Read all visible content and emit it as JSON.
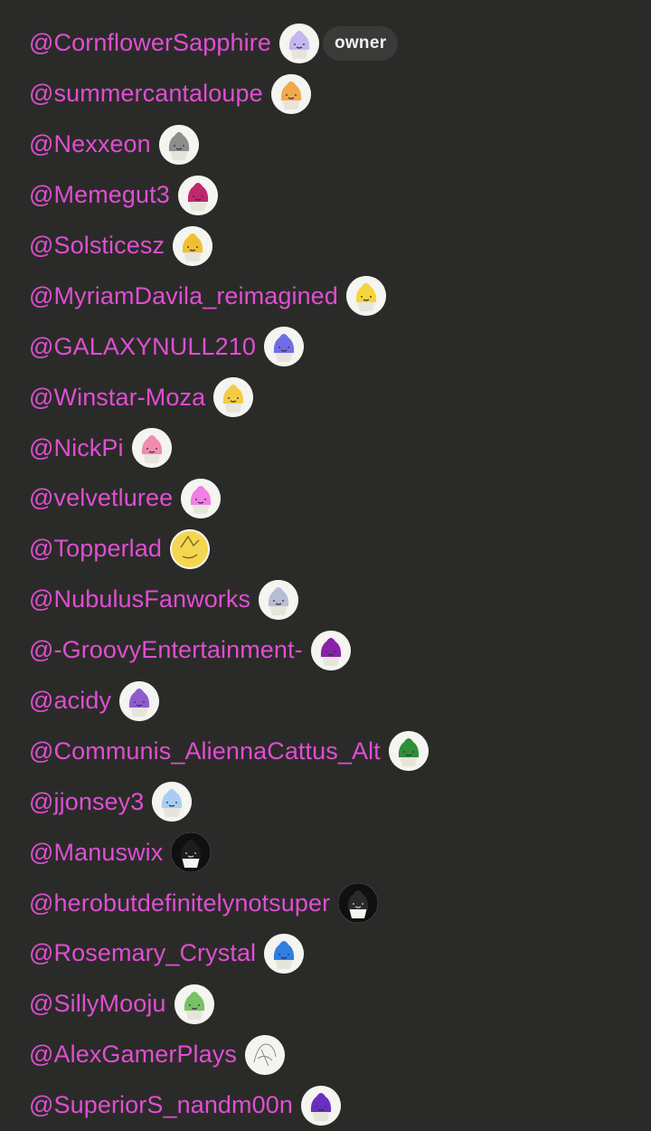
{
  "owner_badge": "owner",
  "members": [
    {
      "handle": "@CornflowerSapphire",
      "avatar_icon": "cupcake-lavender-avatar-icon",
      "color": "#c4b6ef"
    },
    {
      "handle": "@summercantaloupe",
      "avatar_icon": "cantaloupe-avatar-icon",
      "color": "#f2a94a"
    },
    {
      "handle": "@Nexxeon",
      "avatar_icon": "cupcake-gray-avatar-icon",
      "color": "#8d8d8d"
    },
    {
      "handle": "@Memegut3",
      "avatar_icon": "cupcake-red-pink-avatar-icon",
      "color": "#c0286c"
    },
    {
      "handle": "@Solsticesz",
      "avatar_icon": "cupcake-yellow-avatar-icon",
      "color": "#f0c030"
    },
    {
      "handle": "@MyriamDavila_reimagined",
      "avatar_icon": "cupcake-yellow-blue-avatar-icon",
      "color": "#f6d43a"
    },
    {
      "handle": "@GALAXYNULL210",
      "avatar_icon": "cupcake-periwinkle-avatar-icon",
      "color": "#6f6ee8"
    },
    {
      "handle": "@Winstar-Moza",
      "avatar_icon": "cupcake-yellow-avatar-icon",
      "color": "#f2cc45"
    },
    {
      "handle": "@NickPi",
      "avatar_icon": "cupcake-pink-avatar-icon",
      "color": "#f08cad"
    },
    {
      "handle": "@velvetluree",
      "avatar_icon": "cupcake-magenta-avatar-icon",
      "color": "#f07fe6"
    },
    {
      "handle": "@Topperlad",
      "avatar_icon": "yellow-sketch-avatar-icon",
      "color": "#f5d651"
    },
    {
      "handle": "@NubulusFanworks",
      "avatar_icon": "cupcake-silver-avatar-icon",
      "color": "#b8bdd6"
    },
    {
      "handle": "@-GroovyEntertainment-",
      "avatar_icon": "cupcake-purple-avatar-icon",
      "color": "#8a22a8"
    },
    {
      "handle": "@acidy",
      "avatar_icon": "purple-creature-avatar-icon",
      "color": "#8d5cd0"
    },
    {
      "handle": "@Communis_AliennaCattus_Alt",
      "avatar_icon": "green-alien-avatar-icon",
      "color": "#2f8f3a"
    },
    {
      "handle": "@jjonsey3",
      "avatar_icon": "cupcake-light-blue-avatar-icon",
      "color": "#a9cdf2"
    },
    {
      "handle": "@Manuswix",
      "avatar_icon": "cupcake-black-avatar-icon",
      "color": "#1d1d1d"
    },
    {
      "handle": "@herobutdefinitelynotsuper",
      "avatar_icon": "cupcake-black-orange-avatar-icon",
      "color": "#2a2a2a"
    },
    {
      "handle": "@Rosemary_Crystal",
      "avatar_icon": "cupcake-blue-avatar-icon",
      "color": "#2f7fe0"
    },
    {
      "handle": "@SillyMooju",
      "avatar_icon": "cupcake-green-purple-avatar-icon",
      "color": "#79c264"
    },
    {
      "handle": "@AlexGamerPlays",
      "avatar_icon": "line-sketch-avatar-icon",
      "color": "#bdbdbd"
    },
    {
      "handle": "@SuperiorS_nandm00n",
      "avatar_icon": "cupcake-violet-avatar-icon",
      "color": "#6a2fc0"
    }
  ]
}
